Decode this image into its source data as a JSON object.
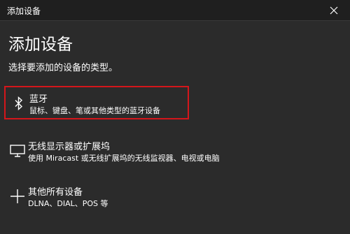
{
  "window": {
    "title": "添加设备",
    "close_icon": "close-icon"
  },
  "main": {
    "heading": "添加设备",
    "subtitle": "选择要添加的设备的类型。"
  },
  "options": [
    {
      "icon": "bluetooth-icon",
      "title": "蓝牙",
      "description": "鼠标、键盘、笔或其他类型的蓝牙设备",
      "selected": true
    },
    {
      "icon": "monitor-icon",
      "title": "无线显示器或扩展坞",
      "description": "使用 Miracast 或无线扩展坞的无线监视器、电视或电脑",
      "selected": false
    },
    {
      "icon": "plus-icon",
      "title": "其他所有设备",
      "description": "DLNA、DIAL、POS 等",
      "selected": false
    }
  ],
  "colors": {
    "background": "#2b2b2b",
    "titlebar": "#1f1f1f",
    "selection_border": "#d4161b",
    "text": "#ffffff"
  }
}
